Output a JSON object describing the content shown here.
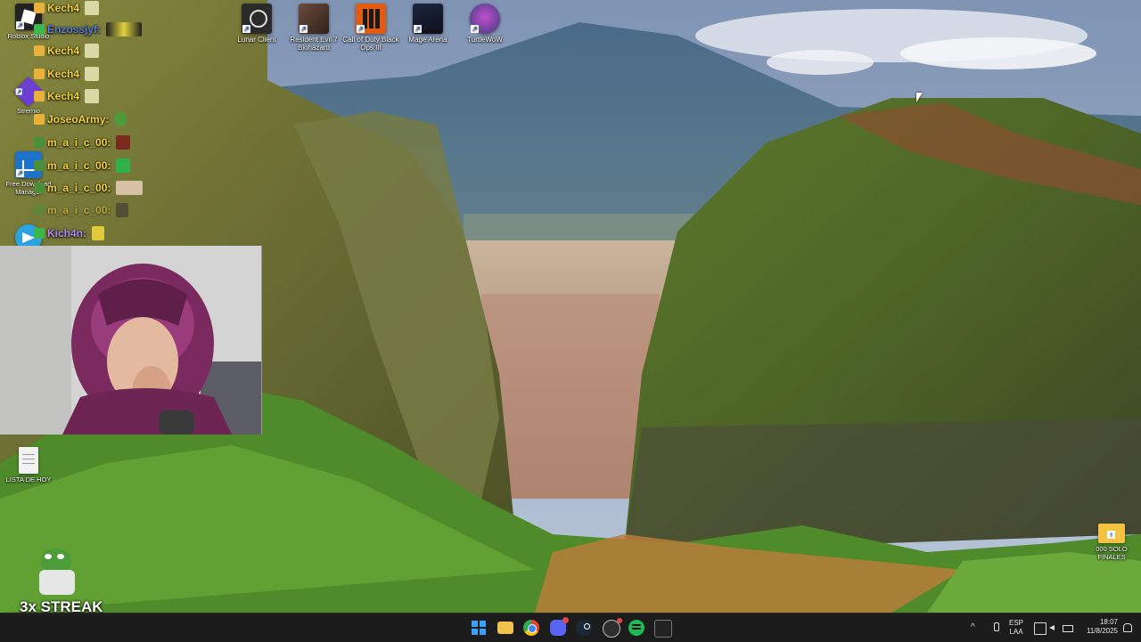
{
  "desktop": {
    "top_icons": [
      {
        "label": "Lunar Client",
        "icon": "lunar-client-icon"
      },
      {
        "label": "Resident Evil 7 Biohazard",
        "icon": "resident-evil-icon"
      },
      {
        "label": "Call of Duty Black Ops III",
        "icon": "call-of-duty-icon"
      },
      {
        "label": "Mage Arena",
        "icon": "mage-arena-icon"
      },
      {
        "label": "TurtleWoW",
        "icon": "turtlewow-icon"
      }
    ],
    "left_icons": [
      {
        "label": "Roblox Studio",
        "icon": "roblox-studio-icon"
      },
      {
        "label": "Stremio",
        "icon": "stremio-icon"
      },
      {
        "label": "Free Download Manager",
        "icon": "free-download-manager-icon"
      },
      {
        "label": "Telegram",
        "icon": "telegram-icon"
      }
    ],
    "file_icon": {
      "label": "LISTA DE HOY",
      "icon": "text-file-icon"
    },
    "folder_icon": {
      "label": "000 SOLO FINALES",
      "icon": "folder-icon"
    }
  },
  "chat": [
    {
      "user": "Kech4",
      "emote": "yellow-emote"
    },
    {
      "user": "Enzossjyf:",
      "emote": "car-emote"
    },
    {
      "user": "Kech4",
      "emote": "yellow-emote"
    },
    {
      "user": "Kech4",
      "emote": "yellow-emote"
    },
    {
      "user": "Kech4",
      "emote": "yellow-emote"
    },
    {
      "user": "JoseoArmy:",
      "emote": "green-emote"
    },
    {
      "user": "m_a_i_c_00:",
      "emote": "red-emote"
    },
    {
      "user": "m_a_i_c_00:",
      "emote": "green-emote"
    },
    {
      "user": "m_a_i_c_00:",
      "emote": "face-emote"
    },
    {
      "user": "m_a_i_c_00:",
      "emote": "dark-emote"
    },
    {
      "user": "Kich4n:",
      "emote": "yellow-emote"
    }
  ],
  "overlay": {
    "streak_text": "3x STREAK",
    "webcam": "webcam-feed"
  },
  "taskbar": {
    "apps": [
      {
        "name": "start",
        "icon": "windows-start-icon"
      },
      {
        "name": "file-explorer",
        "icon": "file-explorer-icon"
      },
      {
        "name": "chrome",
        "icon": "chrome-icon"
      },
      {
        "name": "discord",
        "icon": "discord-icon"
      },
      {
        "name": "steam",
        "icon": "steam-icon"
      },
      {
        "name": "obs",
        "icon": "obs-icon"
      },
      {
        "name": "spotify",
        "icon": "spotify-icon"
      },
      {
        "name": "app",
        "icon": "app-icon"
      }
    ],
    "tray": {
      "lang_line1": "ESP",
      "lang_line2": "LAA",
      "time": "18:07",
      "date": "11/8/2025"
    }
  },
  "colors": {
    "taskbar_bg": "#1c1c1c",
    "chat_name": "#f6d33b",
    "accent": "#0078d4"
  }
}
